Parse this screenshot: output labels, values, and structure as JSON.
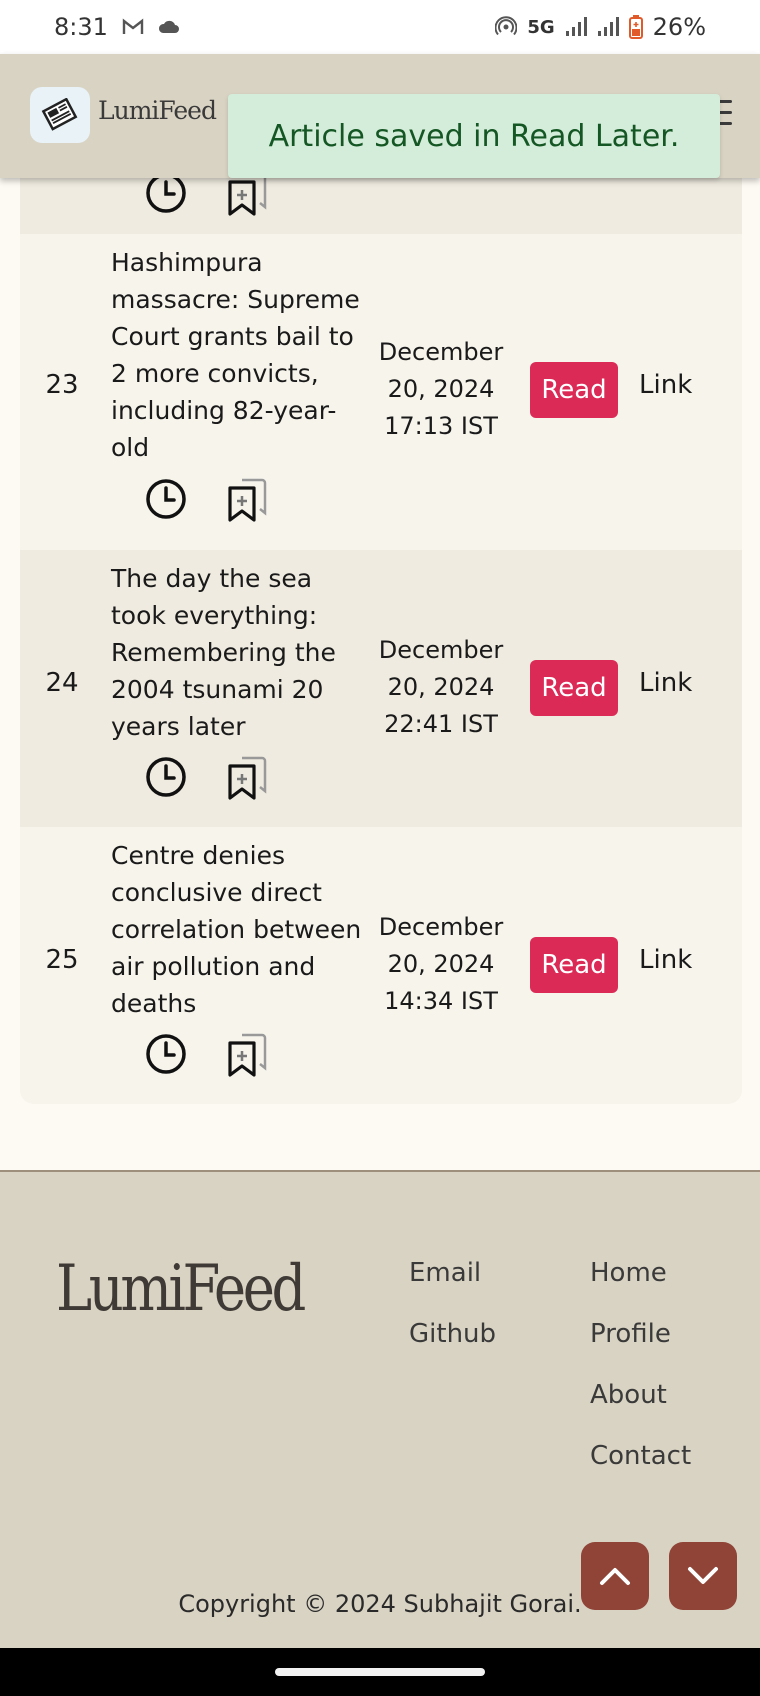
{
  "status_bar": {
    "time": "8:31",
    "left_icons": [
      "gmail-icon",
      "cloud-icon"
    ],
    "network": "5G",
    "battery": "26%"
  },
  "header": {
    "brand": "LumiFeed",
    "logo_icon": "newspaper-icon",
    "menu_icon": "hamburger-menu-icon"
  },
  "toast": {
    "message": "Article saved in Read Later."
  },
  "articles": [
    {
      "num": "23",
      "title": "Hashimpura massacre: Supreme Court grants bail to 2 more convicts, including 82-year-old",
      "date": "December 20, 2024 17:13 IST",
      "read_label": "Read",
      "link_label": "Link"
    },
    {
      "num": "24",
      "title": "The day the sea took everything: Remembering the 2004 tsunami 20 years later",
      "date": "December 20, 2024 22:41 IST",
      "read_label": "Read",
      "link_label": "Link"
    },
    {
      "num": "25",
      "title": "Centre denies conclusive direct correlation between air pollution and deaths",
      "date": "December 20, 2024 14:34 IST",
      "read_label": "Read",
      "link_label": "Link"
    }
  ],
  "footer": {
    "brand": "LumiFeed",
    "col1": [
      "Email",
      "Github"
    ],
    "col2": [
      "Home",
      "Profile",
      "About",
      "Contact"
    ],
    "copyright": "Copyright © 2024 Subhajit Gorai."
  },
  "colors": {
    "read_button": "#dc2a57",
    "scroll_button": "#8f4437",
    "header_bg": "#d9d3c3",
    "toast_bg": "#d4edda",
    "toast_text": "#155724"
  }
}
